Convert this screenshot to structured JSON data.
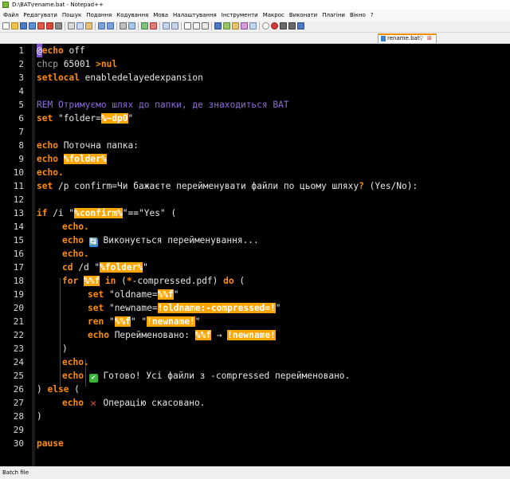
{
  "window": {
    "title": "D:\\BAT\\rename.bat - Notepad++"
  },
  "menu": [
    "Файл",
    "Редагувати",
    "Пошук",
    "Подання",
    "Кодування",
    "Мова",
    "Налаштування",
    "Інструменти",
    "Макрос",
    "Виконати",
    "Плагіни",
    "Вікно",
    "?"
  ],
  "tab": {
    "label": "rename.bat",
    "pin": "⚲",
    "close": "⊠"
  },
  "editor": {
    "line_numbers": [
      "1",
      "2",
      "3",
      "4",
      "5",
      "6",
      "7",
      "8",
      "9",
      "10",
      "11",
      "12",
      "13",
      "14",
      "15",
      "16",
      "17",
      "18",
      "19",
      "20",
      "21",
      "22",
      "23",
      "24",
      "25",
      "26",
      "27",
      "28",
      "29",
      "30"
    ],
    "l1": {
      "at": "@",
      "kw": "echo",
      "rest": " off"
    },
    "l2": {
      "cmd": "chcp",
      "num": " 65001 ",
      "op": ">",
      "kw": "nul"
    },
    "l3": {
      "kw": "setlocal",
      "rest": " enabledelayedexpansion"
    },
    "l5": {
      "comment": "REM Отримуємо шлях до папки, де знаходиться BAT"
    },
    "l6": {
      "kw": "set",
      "a": " \"folder=",
      "v": "%~dp0",
      "b": "\""
    },
    "l8": {
      "kw": "echo",
      "rest": " Поточна папка:"
    },
    "l9": {
      "kw": "echo",
      "sp": " ",
      "v": "%folder%"
    },
    "l10": {
      "kw": "echo."
    },
    "l11": {
      "kw": "set",
      "a": " /p confirm=Чи бажаєте перейменувати файли по цьому шляху",
      "q": "?",
      "b": " (Yes/No):"
    },
    "l13": {
      "kw": "if",
      "a": " /i \"",
      "v": "%confirm%",
      "b": "\"",
      "op": "==",
      "c": "\"Yes\" ("
    },
    "l14": {
      "kw": "echo."
    },
    "l15": {
      "kw": "echo",
      "emoji": "🔄",
      "rest": " Виконується перейменування..."
    },
    "l16": {
      "kw": "echo."
    },
    "l17": {
      "kw": "cd",
      "a": " /d \"",
      "v": "%folder%",
      "b": "\""
    },
    "l18": {
      "kw": "for",
      "sp": " ",
      "v": "%%f",
      "kw2": " in",
      "a": " (",
      "op": "*",
      "b": "-compressed.pdf) ",
      "kw3": "do",
      "c": " ("
    },
    "l19": {
      "kw": "set",
      "a": " \"oldname=",
      "v": "%%f",
      "b": "\""
    },
    "l20": {
      "kw": "set",
      "a": " \"newname=",
      "v": "!oldname:-compressed=!",
      "b": "\""
    },
    "l21": {
      "kw": "ren",
      "a": " \"",
      "v": "%%f",
      "b": "\" \"",
      "v2": "!newname!",
      "c": "\""
    },
    "l22": {
      "kw": "echo",
      "a": " Перейменовано: ",
      "v": "%%f",
      "arrow": " → ",
      "v2": "!newname!"
    },
    "l23": {
      "text": ")"
    },
    "l24": {
      "kw": "echo."
    },
    "l25": {
      "kw": "echo",
      "emoji": "✔",
      "rest": " Готово! Усі файли з -compressed перейменовано."
    },
    "l26": {
      "a": ") ",
      "kw": "else",
      "b": " ("
    },
    "l27": {
      "kw": "echo",
      "emoji": "✕",
      "rest": " Операцію скасовано."
    },
    "l28": {
      "text": ")"
    },
    "l30": {
      "kw": "pause"
    }
  },
  "status": {
    "file_type": "Batch file"
  }
}
